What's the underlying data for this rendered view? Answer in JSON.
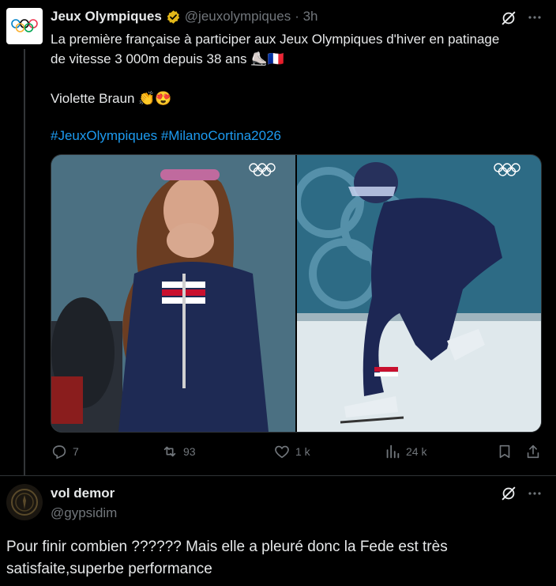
{
  "tweet": {
    "author_name": "Jeux Olympiques",
    "handle": "@jeuxolympiques",
    "time": "· 3h",
    "line1": "La première française à participer aux Jeux Olympiques d'hiver en patinage",
    "line2": "de vitesse 3 000m depuis 38 ans ⛸️🇫🇷",
    "line3": "Violette Braun 👏😍",
    "hashtags": "#JeuxOlympiques #MilanoCortina2026",
    "replies": "7",
    "reposts": "93",
    "likes": "1 k",
    "views": "24 k"
  },
  "reply": {
    "author_name": "vol demor",
    "handle": "@gypsidim",
    "text_line1": "Pour finir combien ?????? Mais elle a pleuré donc la Fede est très",
    "text_line2": "satisfaite,superbe performance"
  },
  "colors": {
    "background": "#000000",
    "text": "#e7e9ea",
    "muted": "#71767b",
    "link": "#1d9bf0",
    "verified_gold": "#e2b719"
  }
}
